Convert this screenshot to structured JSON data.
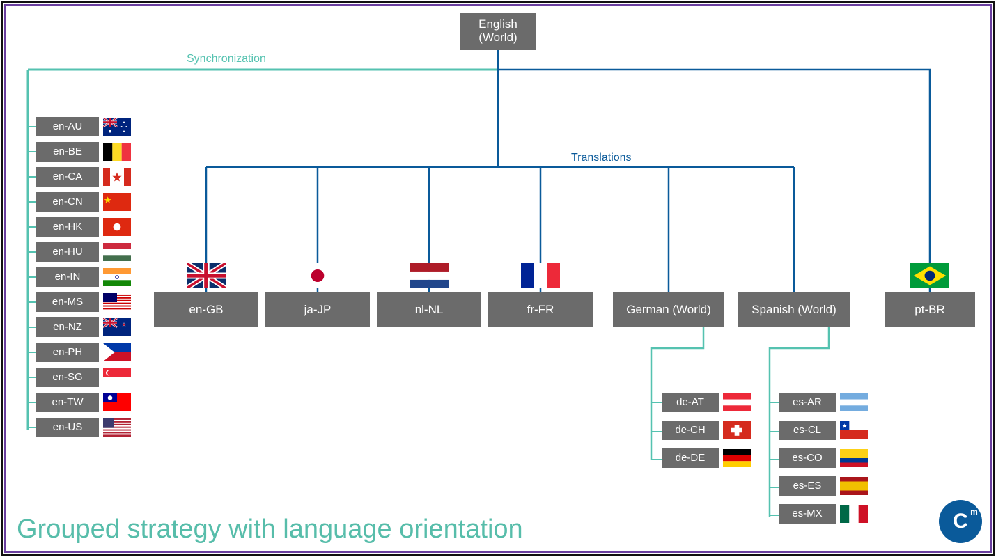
{
  "root": {
    "line1": "English",
    "line2": "(World)"
  },
  "labels": {
    "sync": "Synchronization",
    "translations": "Translations"
  },
  "title": "Grouped strategy with language orientation",
  "en_list": [
    "en-AU",
    "en-BE",
    "en-CA",
    "en-CN",
    "en-HK",
    "en-HU",
    "en-IN",
    "en-MS",
    "en-NZ",
    "en-PH",
    "en-SG",
    "en-TW",
    "en-US"
  ],
  "en_flags": [
    "au",
    "be",
    "ca",
    "cn",
    "hk",
    "hu",
    "in",
    "ms",
    "nz",
    "ph",
    "sg",
    "tw",
    "us"
  ],
  "trans": [
    {
      "code": "en-GB",
      "flag": "gb"
    },
    {
      "code": "ja-JP",
      "flag": "jp"
    },
    {
      "code": "nl-NL",
      "flag": "nl"
    },
    {
      "code": "fr-FR",
      "flag": "fr"
    },
    {
      "code": "German (World)",
      "flag": ""
    },
    {
      "code": "Spanish (World)",
      "flag": ""
    },
    {
      "code": "pt-BR",
      "flag": "br"
    }
  ],
  "de_list": [
    "de-AT",
    "de-CH",
    "de-DE"
  ],
  "de_flags": [
    "at",
    "ch",
    "de"
  ],
  "es_list": [
    "es-AR",
    "es-CL",
    "es-CO",
    "es-ES",
    "es-MX"
  ],
  "es_flags": [
    "ar",
    "cl",
    "co",
    "es",
    "mx"
  ],
  "colors": {
    "teal": "#55c2b0",
    "blue": "#0a5a9a",
    "box": "#6b6b6b"
  },
  "logo": {
    "letter": "C",
    "sup": "m"
  }
}
